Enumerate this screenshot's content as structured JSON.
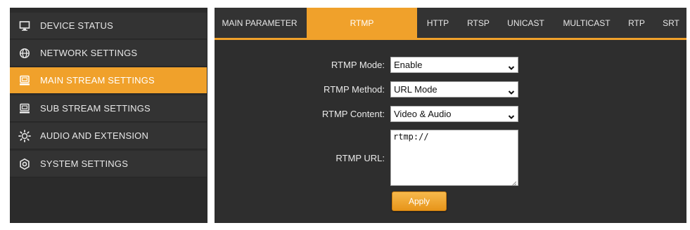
{
  "sidebar": {
    "items": [
      {
        "label": "DEVICE STATUS",
        "icon": "monitor-icon"
      },
      {
        "label": "NETWORK SETTINGS",
        "icon": "globe-icon"
      },
      {
        "label": "MAIN STREAM SETTINGS",
        "icon": "stream-icon",
        "active": true
      },
      {
        "label": "SUB STREAM SETTINGS",
        "icon": "stream-icon"
      },
      {
        "label": "AUDIO AND EXTENSION",
        "icon": "audio-extension-icon"
      },
      {
        "label": "SYSTEM SETTINGS",
        "icon": "gear-icon"
      }
    ]
  },
  "tabs": [
    {
      "label": "MAIN PARAMETER"
    },
    {
      "label": "RTMP",
      "active": true
    },
    {
      "label": "HTTP"
    },
    {
      "label": "RTSP"
    },
    {
      "label": "UNICAST"
    },
    {
      "label": "MULTICAST"
    },
    {
      "label": "RTP"
    },
    {
      "label": "SRT"
    }
  ],
  "form": {
    "rtmp_mode": {
      "label": "RTMP Mode:",
      "value": "Enable"
    },
    "rtmp_method": {
      "label": "RTMP Method:",
      "value": "URL Mode"
    },
    "rtmp_content": {
      "label": "RTMP Content:",
      "value": "Video & Audio"
    },
    "rtmp_url": {
      "label": "RTMP URL:",
      "value": "rtmp://"
    },
    "apply_label": "Apply"
  },
  "colors": {
    "accent": "#f0a12b",
    "panel": "#2e2e2e",
    "sidebar_item": "#333333"
  }
}
